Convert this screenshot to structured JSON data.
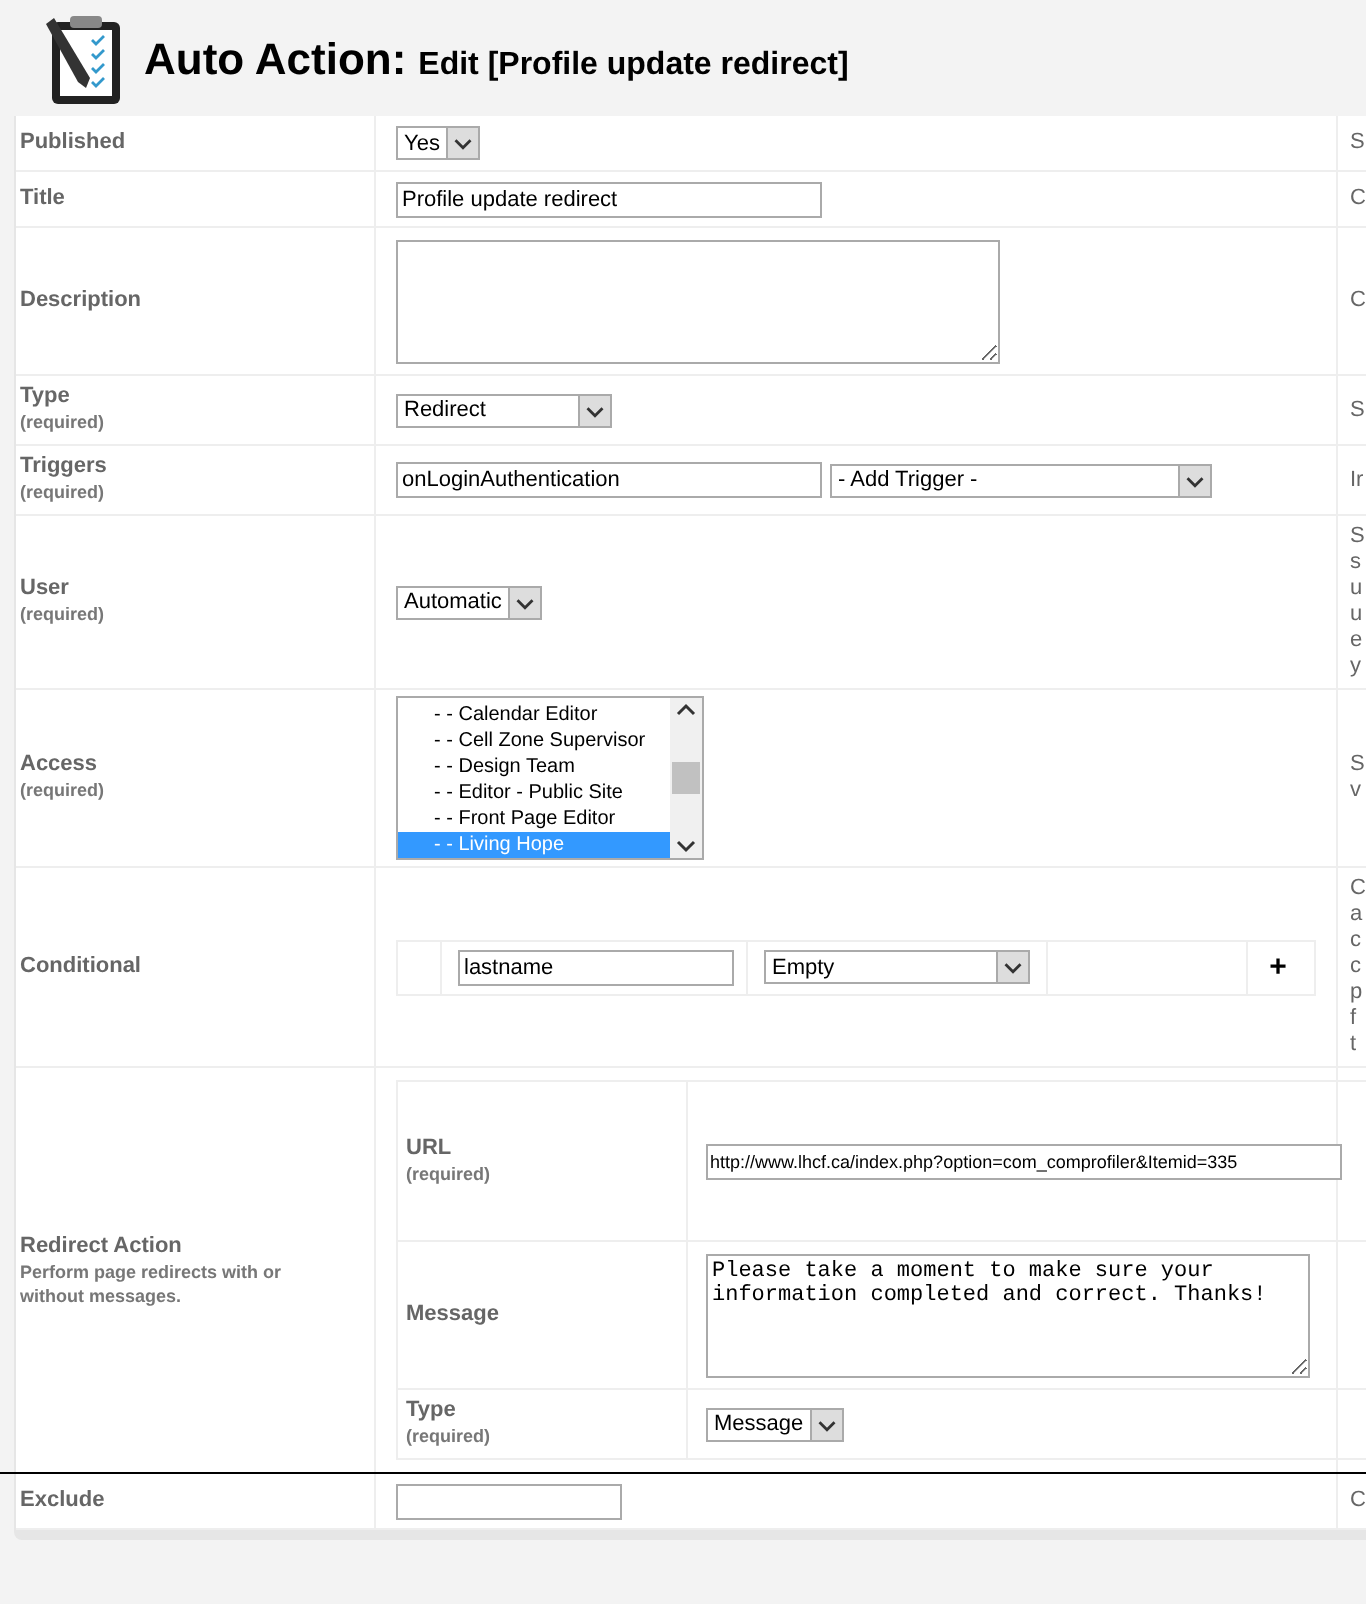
{
  "header": {
    "title": "Auto Action:",
    "subtitle": "Edit [Profile update redirect]"
  },
  "rows": [
    {
      "kind": "select",
      "label": "Published",
      "value": "Yes",
      "help": [
        "S"
      ]
    },
    {
      "kind": "text",
      "label": "Title",
      "value": "Profile update redirect",
      "help": [
        "C"
      ]
    },
    {
      "kind": "textarea",
      "label": "Description",
      "help": [
        "C"
      ]
    },
    {
      "kind": "select",
      "label": "Type",
      "note": "(required)",
      "value": "Redirect",
      "help": [
        "S"
      ]
    },
    {
      "kind": "triggers",
      "label": "Triggers",
      "note": "(required)",
      "value": "onLoginAuthentication",
      "add": "- Add Trigger -",
      "help": [
        "Ir"
      ]
    },
    {
      "kind": "select",
      "label": "User",
      "note": "(required)",
      "value": "Automatic",
      "help": [
        "S",
        "s",
        "u",
        "u",
        "e",
        "y"
      ]
    },
    {
      "kind": "listbox",
      "label": "Access",
      "note": "(required)",
      "options": [
        {
          "label": "- - Calendar Editor",
          "selected": false
        },
        {
          "label": "- - Cell Zone Supervisor",
          "selected": false
        },
        {
          "label": "- - Design Team",
          "selected": false
        },
        {
          "label": "- - Editor - Public Site",
          "selected": false
        },
        {
          "label": "- - Front Page Editor",
          "selected": false
        },
        {
          "label": "- - Living Hope",
          "selected": true
        }
      ],
      "help": [
        "S",
        "v"
      ]
    },
    {
      "kind": "conditional",
      "label": "Conditional",
      "field": "lastname",
      "operator": "Empty",
      "add": "+",
      "help": [
        "C",
        "a",
        "c",
        "c",
        "p",
        "f",
        "t"
      ]
    },
    {
      "kind": "redirect",
      "label": "Redirect Action",
      "description": "Perform page redirects with or without messages.",
      "fields": [
        {
          "kind": "text",
          "label": "URL",
          "note": "(required)",
          "value": "http://www.lhcf.ca/index.php?option=com_comprofiler&Itemid=335"
        },
        {
          "kind": "textarea",
          "label": "Message",
          "value": "Please take a moment to make sure your information completed and correct. Thanks!"
        },
        {
          "kind": "select",
          "label": "Type",
          "note": "(required)",
          "value": "Message"
        }
      ]
    },
    {
      "kind": "text",
      "label": "Exclude",
      "help": [
        "C"
      ]
    }
  ]
}
